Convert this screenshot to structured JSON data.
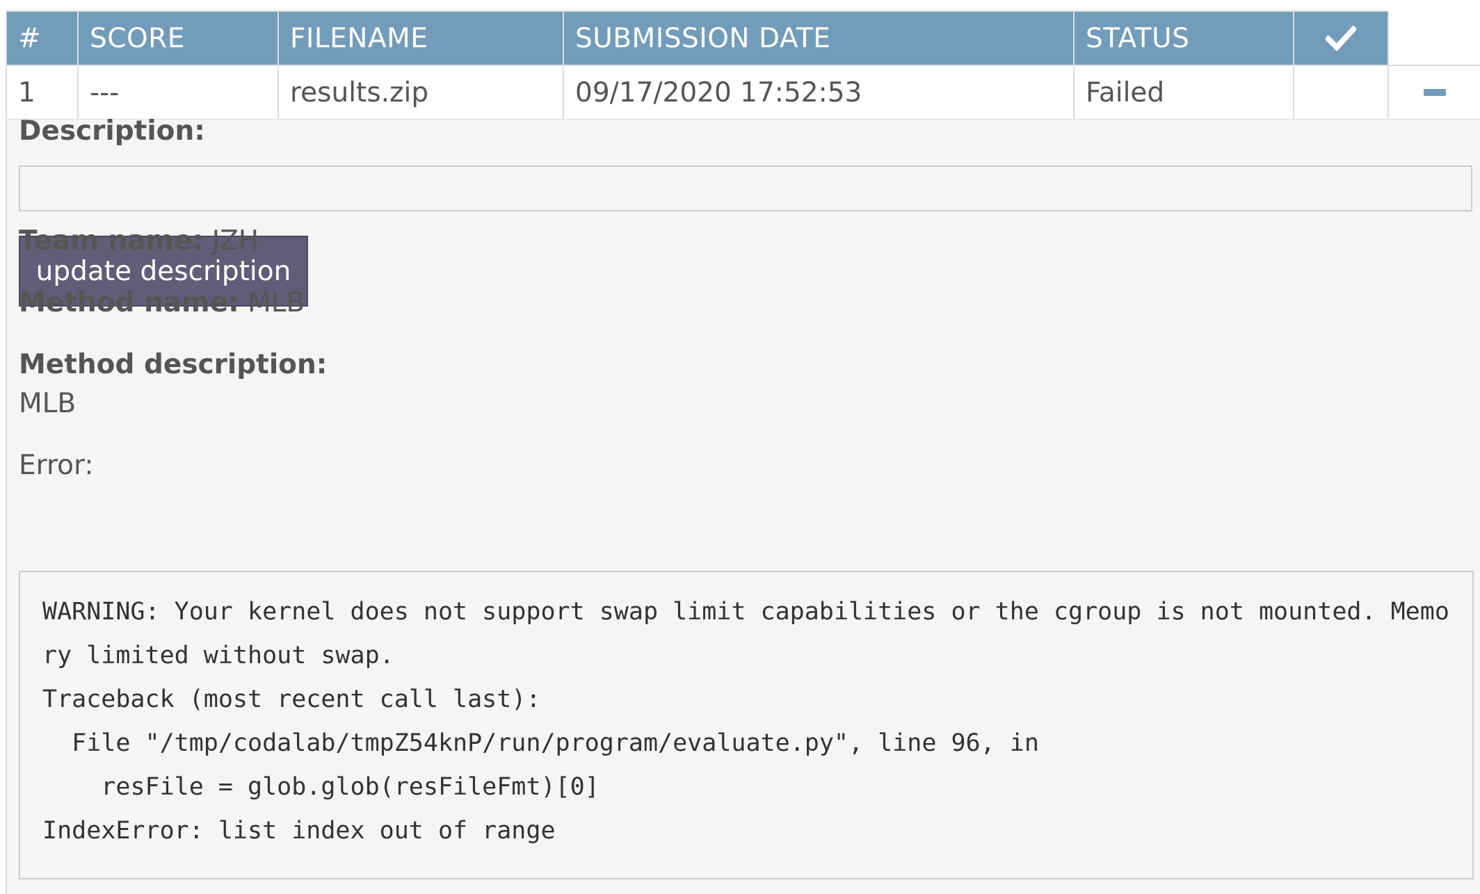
{
  "table": {
    "headers": {
      "number": "#",
      "score": "SCORE",
      "filename": "FILENAME",
      "submission_date": "SUBMISSION DATE",
      "status": "STATUS",
      "check_icon": "checkmark-icon"
    },
    "row": {
      "number": "1",
      "score": "---",
      "filename": "results.zip",
      "submission_date": "09/17/2020 17:52:53",
      "status": "Failed",
      "toggle_icon": "minus-icon"
    }
  },
  "details": {
    "description_label": "Description:",
    "description_value": "",
    "update_button_label": "update description",
    "team_name_label": "Team name:",
    "team_name_value": " JZH",
    "method_name_label": "Method name:",
    "method_name_value": " MLB",
    "method_description_label": "Method description:",
    "method_description_value": "MLB",
    "error_label": "Error:",
    "error_text": "WARNING: Your kernel does not support swap limit capabilities or the cgroup is not mounted. Memory limited without swap.\nTraceback (most recent call last):\n  File \"/tmp/codalab/tmpZ54knP/run/program/evaluate.py\", line 96, in \n    resFile = glob.glob(resFileFmt)[0]\nIndexError: list index out of range"
  },
  "colors": {
    "header_bg": "#739cba",
    "button_bg": "#635c76",
    "panel_bg": "#f5f5f5"
  }
}
